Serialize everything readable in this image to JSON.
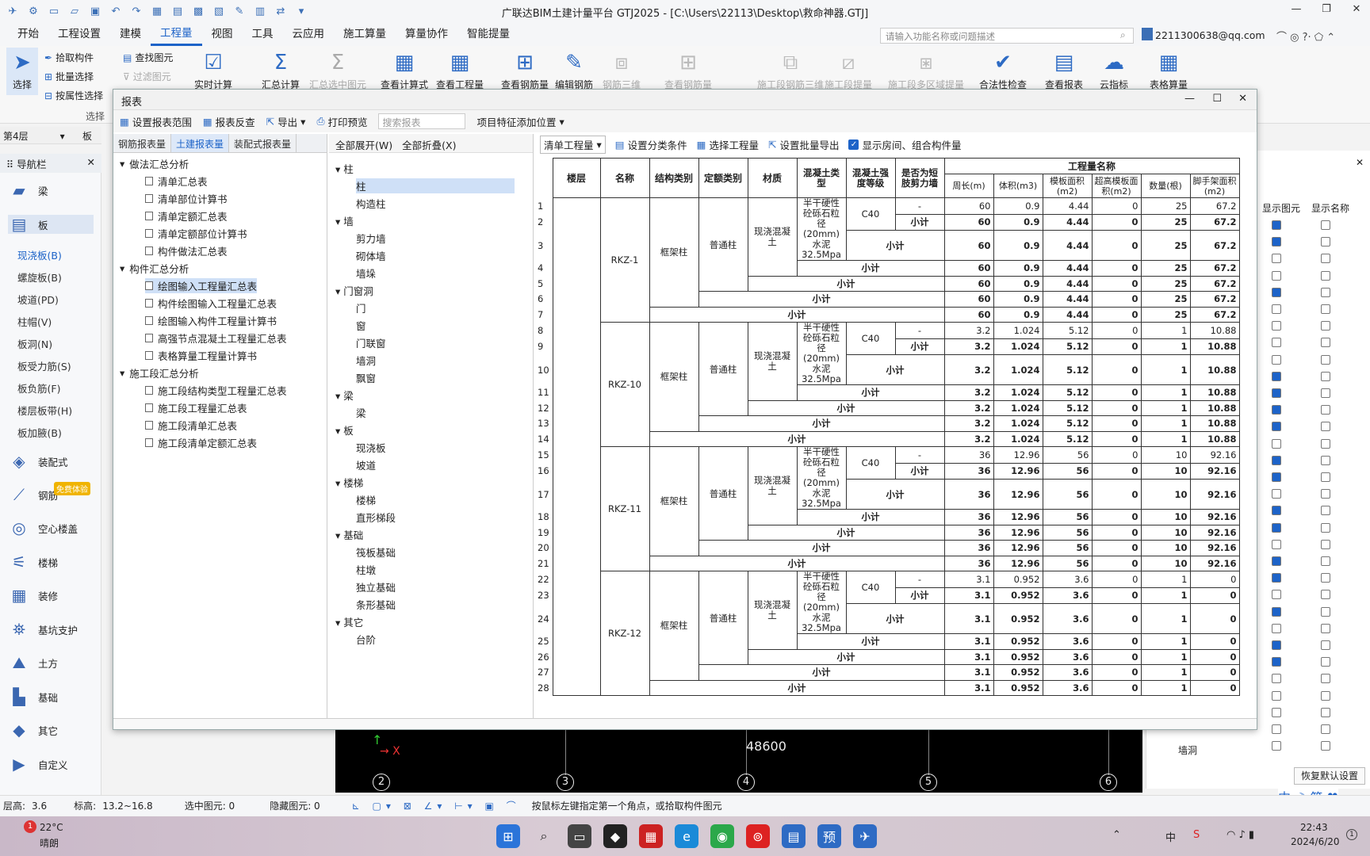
{
  "app": {
    "title": "广联达BIM土建计量平台 GTJ2025 - [C:\\Users\\22113\\Desktop\\救命神器.GTJ]"
  },
  "menu": [
    "开始",
    "工程设置",
    "建模",
    "工程量",
    "视图",
    "工具",
    "云应用",
    "施工算量",
    "算量协作",
    "智能提量"
  ],
  "search": {
    "placeholder": "请输入功能名称或问题描述"
  },
  "account": "2211300638@qq.com",
  "ribbon": {
    "select": "选择",
    "pick": "拾取构件",
    "batch": "批量选择",
    "byattr": "按属性选择",
    "find": "查找图元",
    "filter": "过滤图元",
    "group": "选择",
    "big": [
      "实时计算",
      "汇总计算",
      "汇总选中图元",
      "查看计算式",
      "查看工程量",
      "查看钢筋量",
      "编辑钢筋",
      "钢筋三维",
      "查看钢筋量",
      "施工段钢筋三维",
      "施工段提量",
      "施工段多区域提量",
      "合法性检查",
      "查看报表",
      "云指标",
      "表格算量"
    ]
  },
  "floor": {
    "label": "第4层",
    "type": "板"
  },
  "nav": {
    "title": "导航栏",
    "items": [
      "梁",
      "板",
      "装配式",
      "钢筋",
      "空心楼盖",
      "楼梯",
      "装修",
      "基坑支护",
      "土方",
      "基础",
      "其它",
      "自定义"
    ],
    "free": "免费体验",
    "subs": [
      "现浇板(B)",
      "螺旋板(B)",
      "坡道(PD)",
      "柱帽(V)",
      "板洞(N)",
      "板受力筋(S)",
      "板负筋(F)",
      "楼层板带(H)",
      "板加腋(B)"
    ]
  },
  "report": {
    "title": "报表",
    "toolbar": [
      "设置报表范围",
      "报表反查",
      "导出",
      "打印预览",
      "项目特征添加位置"
    ],
    "search_placeholder": "搜索报表",
    "tabs": [
      "钢筋报表量",
      "土建报表量",
      "装配式报表量"
    ],
    "tree": [
      {
        "t": "做法汇总分析",
        "lvl": 0
      },
      {
        "t": "清单汇总表",
        "lvl": 1
      },
      {
        "t": "清单部位计算书",
        "lvl": 1
      },
      {
        "t": "清单定额汇总表",
        "lvl": 1
      },
      {
        "t": "清单定额部位计算书",
        "lvl": 1
      },
      {
        "t": "构件做法汇总表",
        "lvl": 1
      },
      {
        "t": "构件汇总分析",
        "lvl": 0
      },
      {
        "t": "绘图输入工程量汇总表",
        "lvl": 1,
        "sel": true
      },
      {
        "t": "构件绘图输入工程量汇总表",
        "lvl": 1
      },
      {
        "t": "绘图输入构件工程量计算书",
        "lvl": 1
      },
      {
        "t": "高强节点混凝土工程量汇总表",
        "lvl": 1
      },
      {
        "t": "表格算量工程量计算书",
        "lvl": 1
      },
      {
        "t": "施工段汇总分析",
        "lvl": 0
      },
      {
        "t": "施工段结构类型工程量汇总表",
        "lvl": 1
      },
      {
        "t": "施工段工程量汇总表",
        "lvl": 1
      },
      {
        "t": "施工段清单汇总表",
        "lvl": 1
      },
      {
        "t": "施工段清单定额汇总表",
        "lvl": 1
      }
    ],
    "expand_all": "全部展开(W)",
    "collapse_all": "全部折叠(X)",
    "mid": [
      {
        "t": "柱",
        "lvl": 0
      },
      {
        "t": "柱",
        "lvl": 1,
        "sel": true
      },
      {
        "t": "构造柱",
        "lvl": 1
      },
      {
        "t": "墙",
        "lvl": 0
      },
      {
        "t": "剪力墙",
        "lvl": 1
      },
      {
        "t": "砌体墙",
        "lvl": 1
      },
      {
        "t": "墙垛",
        "lvl": 1
      },
      {
        "t": "门窗洞",
        "lvl": 0
      },
      {
        "t": "门",
        "lvl": 1
      },
      {
        "t": "窗",
        "lvl": 1
      },
      {
        "t": "门联窗",
        "lvl": 1
      },
      {
        "t": "墙洞",
        "lvl": 1
      },
      {
        "t": "飘窗",
        "lvl": 1
      },
      {
        "t": "梁",
        "lvl": 0
      },
      {
        "t": "梁",
        "lvl": 1
      },
      {
        "t": "板",
        "lvl": 0
      },
      {
        "t": "现浇板",
        "lvl": 1
      },
      {
        "t": "坡道",
        "lvl": 1
      },
      {
        "t": "楼梯",
        "lvl": 0
      },
      {
        "t": "楼梯",
        "lvl": 1
      },
      {
        "t": "直形梯段",
        "lvl": 1
      },
      {
        "t": "基础",
        "lvl": 0
      },
      {
        "t": "筏板基础",
        "lvl": 1
      },
      {
        "t": "柱墩",
        "lvl": 1
      },
      {
        "t": "独立基础",
        "lvl": 1
      },
      {
        "t": "条形基础",
        "lvl": 1
      },
      {
        "t": "其它",
        "lvl": 0
      },
      {
        "t": "台阶",
        "lvl": 1
      }
    ],
    "grid_toolbar": {
      "combo": "清单工程量",
      "cond": "设置分类条件",
      "sel": "选择工程量",
      "batch": "设置批量导出",
      "show": "显示房间、组合构件量"
    },
    "headers": {
      "floor": "楼层",
      "name": "名称",
      "struct": "结构类别",
      "quota": "定额类别",
      "mat": "材质",
      "conc": "混凝土类型",
      "grade": "混凝土强度等级",
      "short": "是否为短肢剪力墙",
      "group": "工程量名称",
      "cols": [
        "周长(m)",
        "体积(m3)",
        "模板面积(m2)",
        "超高模板面积(m2)",
        "数量(根)",
        "脚手架面积(m2)"
      ]
    },
    "labels": {
      "struct": "框架柱",
      "quota": "普通柱",
      "mat": "现浇混凝土",
      "conc": "半干硬性砼砾石粒径(20mm)水泥32.5Mpa",
      "grade": "C40",
      "dash": "-",
      "sub": "小计"
    },
    "groups": [
      {
        "name": "RKZ-1",
        "vals": [
          "60",
          "0.9",
          "4.44",
          "0",
          "25",
          "67.2"
        ]
      },
      {
        "name": "RKZ-10",
        "vals": [
          "3.2",
          "1.024",
          "5.12",
          "0",
          "1",
          "10.88"
        ]
      },
      {
        "name": "RKZ-11",
        "vals": [
          "36",
          "12.96",
          "56",
          "0",
          "10",
          "92.16"
        ]
      },
      {
        "name": "RKZ-12",
        "vals": [
          "3.1",
          "0.952",
          "3.6",
          "0",
          "1",
          "0"
        ]
      }
    ]
  },
  "canvas": {
    "dim": "48600",
    "axes": [
      "2",
      "3",
      "4",
      "5",
      "6"
    ]
  },
  "rightpanel": {
    "col1": "显示图元",
    "col2": "显示名称",
    "restore": "恢复默认设置",
    "item": "墙洞"
  },
  "status": {
    "floorh_label": "层高:",
    "floorh": "3.6",
    "elev_label": "标高:",
    "elev": "13.2~16.8",
    "sel": "选中图元: 0",
    "hid": "隐藏图元: 0",
    "hint": "按鼠标左键指定第一个角点，或拾取构件图元"
  },
  "taskbar": {
    "temp": "22°C",
    "weather": "晴朗",
    "time": "22:43",
    "date": "2024/6/20",
    "ime": "中",
    "notif": "1"
  }
}
